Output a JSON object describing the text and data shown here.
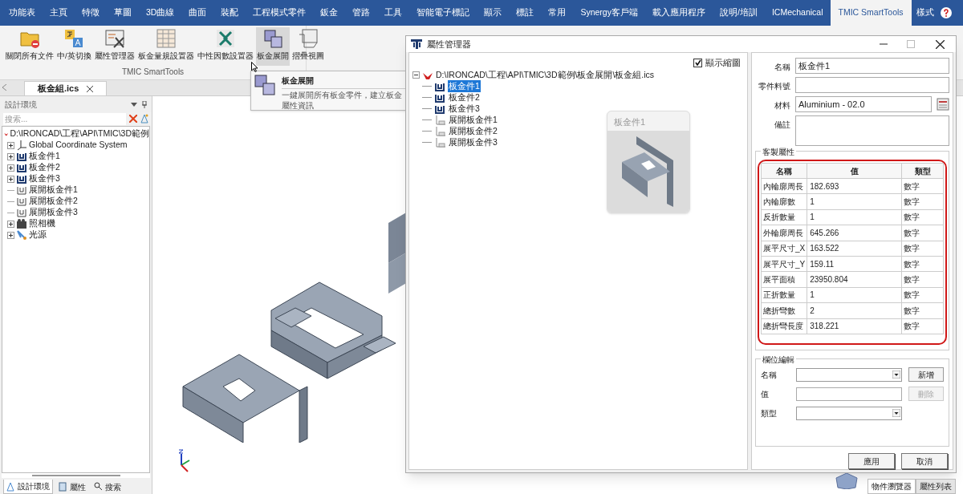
{
  "menu_tabs": [
    {
      "label": "功能表",
      "selected": false
    },
    {
      "label": "主頁",
      "selected": false
    },
    {
      "label": "特徵",
      "selected": false
    },
    {
      "label": "草圖",
      "selected": false
    },
    {
      "label": "3D曲線",
      "selected": false
    },
    {
      "label": "曲面",
      "selected": false
    },
    {
      "label": "裝配",
      "selected": false
    },
    {
      "label": "工程模式零件",
      "selected": false
    },
    {
      "label": "鈑金",
      "selected": false
    },
    {
      "label": "管路",
      "selected": false
    },
    {
      "label": "工具",
      "selected": false
    },
    {
      "label": "智能電子標記",
      "selected": false
    },
    {
      "label": "顯示",
      "selected": false
    },
    {
      "label": "標註",
      "selected": false
    },
    {
      "label": "常用",
      "selected": false
    },
    {
      "label": "Synergy客戶端",
      "selected": false
    },
    {
      "label": "載入應用程序",
      "selected": false
    },
    {
      "label": "說明/培訓",
      "selected": false
    },
    {
      "label": "ICMechanical",
      "selected": false
    },
    {
      "label": "TMIC SmartTools",
      "selected": true
    }
  ],
  "style_menu": "樣式",
  "ribbon": {
    "group_label": "TMIC SmartTools",
    "buttons": [
      {
        "label": "關閉所有文件",
        "kind": "close-docs",
        "selected": false
      },
      {
        "label": "中/英切換",
        "kind": "translate",
        "selected": false
      },
      {
        "label": "屬性管理器",
        "kind": "property",
        "selected": false
      },
      {
        "label": "板金量規設置器",
        "kind": "gauge",
        "selected": false
      },
      {
        "label": "中性因數設置器",
        "kind": "kfactor",
        "selected": false
      },
      {
        "label": "板金展開",
        "kind": "unfold",
        "selected": true
      },
      {
        "label": "摺疊視圖",
        "kind": "fold",
        "selected": false
      }
    ]
  },
  "tooltip": {
    "title": "板金展開",
    "description": "一鍵展開所有板金零件，建立板金屬性資訊"
  },
  "document_tab": {
    "label": "板金組.ics"
  },
  "design_panel": {
    "title": "設計環境",
    "search_placeholder": "搜索...",
    "tree": [
      {
        "label": "D:\\IRONCAD\\工程\\API\\TMIC\\3D範例",
        "kind": "assembly",
        "expander": false
      },
      {
        "label": "Global Coordinate System",
        "kind": "coord",
        "expander": true
      },
      {
        "label": "板金件1",
        "kind": "part",
        "expander": true
      },
      {
        "label": "板金件2",
        "kind": "part",
        "expander": true
      },
      {
        "label": "板金件3",
        "kind": "part",
        "expander": true
      },
      {
        "label": "展開板金件1",
        "kind": "unfolded",
        "expander": false
      },
      {
        "label": "展開板金件2",
        "kind": "unfolded",
        "expander": false
      },
      {
        "label": "展開板金件3",
        "kind": "unfolded",
        "expander": false
      },
      {
        "label": "照相機",
        "kind": "camera",
        "expander": true
      },
      {
        "label": "光源",
        "kind": "light",
        "expander": true
      }
    ],
    "bottom_tabs": [
      {
        "label": "設計環境",
        "kind": "design",
        "selected": true
      },
      {
        "label": "屬性",
        "kind": "property",
        "selected": false
      },
      {
        "label": "搜索",
        "kind": "search",
        "selected": false
      }
    ]
  },
  "dialog": {
    "title": "屬性管理器",
    "show_preview": {
      "label": "顯示縮圖",
      "checked": true
    },
    "tree": {
      "label": "D:\\IRONCAD\\工程\\API\\TMIC\\3D範例\\板金展開\\板金組.ics",
      "expanded": true,
      "children": [
        {
          "label": "板金件1",
          "kind": "part",
          "selected": true
        },
        {
          "label": "板金件2",
          "kind": "part",
          "selected": false
        },
        {
          "label": "板金件3",
          "kind": "part",
          "selected": false
        },
        {
          "label": "展開板金件1",
          "kind": "flat",
          "selected": false
        },
        {
          "label": "展開板金件2",
          "kind": "flat",
          "selected": false
        },
        {
          "label": "展開板金件3",
          "kind": "flat",
          "selected": false
        }
      ]
    },
    "preview_title": "板金件1",
    "fields": [
      {
        "label": "名稱",
        "value": "板金件1",
        "kind": "text"
      },
      {
        "label": "零件料號",
        "kind": "text"
      },
      {
        "label": "材料",
        "value": "Aluminium - 02.0",
        "kind": "picker"
      },
      {
        "label": "備註",
        "kind": "memo"
      }
    ],
    "custom_group": "客製屬性",
    "table": {
      "columns": [
        "名稱",
        "值",
        "類型"
      ],
      "rows": [
        [
          "內輪廓周長",
          "182.693",
          "數字"
        ],
        [
          "內輪廓數",
          "1",
          "數字"
        ],
        [
          "反折數量",
          "1",
          "數字"
        ],
        [
          "外輪廓周長",
          "645.266",
          "數字"
        ],
        [
          "展平尺寸_X",
          "163.522",
          "數字"
        ],
        [
          "展平尺寸_Y",
          "159.11",
          "數字"
        ],
        [
          "展平面積",
          "23950.804",
          "數字"
        ],
        [
          "正折數量",
          "1",
          "數字"
        ],
        [
          "總折彎數",
          "2",
          "數字"
        ],
        [
          "總折彎長度",
          "318.221",
          "數字"
        ]
      ]
    },
    "edit_group": "欄位編輯",
    "edit_fields": [
      {
        "label": "名稱",
        "kind": "combo",
        "button": {
          "label": "新增",
          "disabled": false
        }
      },
      {
        "label": "值",
        "kind": "text",
        "button": {
          "label": "刪除",
          "disabled": true
        }
      },
      {
        "label": "類型",
        "kind": "combo"
      }
    ],
    "buttons": [
      "應用",
      "取消"
    ]
  },
  "right_tabs": [
    {
      "label": "物件瀏覽器",
      "selected": true
    },
    {
      "label": "屬性列表",
      "selected": false
    }
  ]
}
